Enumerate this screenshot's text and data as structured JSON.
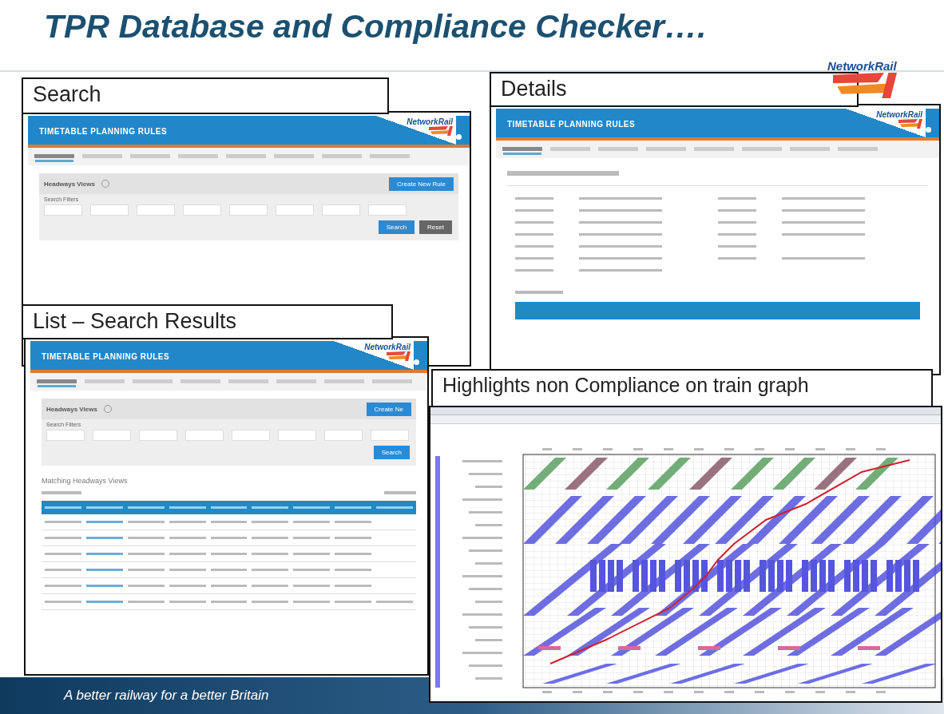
{
  "title": "TPR Database and Compliance Checker….",
  "logo": "NetworkRail",
  "panels": [
    {
      "kind": "search",
      "caption": "Search",
      "app_title": "TIMETABLE PLANNING RULES",
      "logo": "NetworkRail",
      "section": "Headways Views",
      "filters_label": "Search Filters",
      "buttons": [
        "Create New Rule",
        "Search",
        "Reset"
      ]
    },
    {
      "kind": "details",
      "caption": "Details",
      "app_title": "TIMETABLE PLANNING RULES",
      "logo": "NetworkRail"
    },
    {
      "kind": "list",
      "caption": "List – Search Results",
      "app_title": "TIMETABLE PLANNING RULES",
      "logo": "NetworkRail",
      "section": "Headways Views",
      "filters_label": "Search Filters",
      "buttons": [
        "Create Ne",
        "Search"
      ],
      "results_heading": "Matching Headways Views"
    },
    {
      "kind": "graph",
      "caption": "Highlights  non Compliance  on train graph"
    }
  ],
  "footer": "A better railway for a better Britain"
}
